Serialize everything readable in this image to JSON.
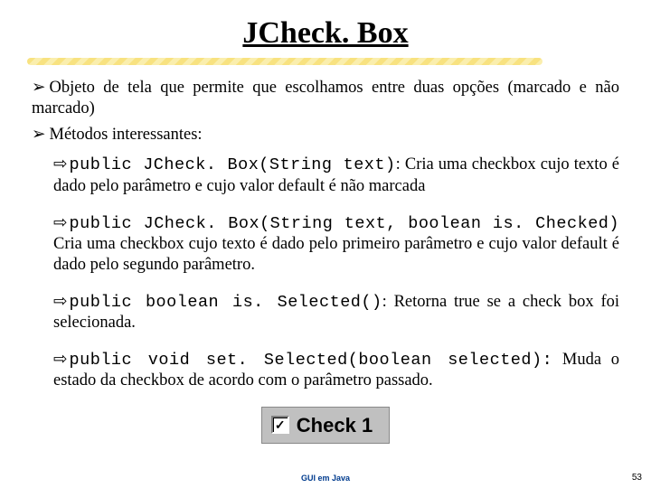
{
  "title": "JCheck. Box",
  "bullets": [
    "Objeto de tela que permite que escolhamos entre duas opções (marcado e não marcado)",
    "Métodos interessantes:"
  ],
  "subs": [
    {
      "code": "public JCheck. Box(String text)",
      "desc": ": Cria uma checkbox cujo texto é dado pelo parâmetro e cujo valor default é não marcada"
    },
    {
      "code": "public JCheck. Box(String text, boolean is. Checked)",
      "desc": " Cria uma checkbox cujo texto é dado pelo primeiro parâmetro e cujo valor default é dado pelo segundo parâmetro."
    },
    {
      "code": "public boolean is. Selected()",
      "desc": ": Retorna true se a check box foi selecionada."
    },
    {
      "code": "public void set. Selected(boolean selected):",
      "desc": " Muda o estado da checkbox de acordo com o parâmetro passado."
    }
  ],
  "demo": {
    "label": "Check 1",
    "tick": "✓"
  },
  "footer": "GUI em Java",
  "page": "53",
  "sym_main": "➢",
  "sym_sub": "⇨"
}
